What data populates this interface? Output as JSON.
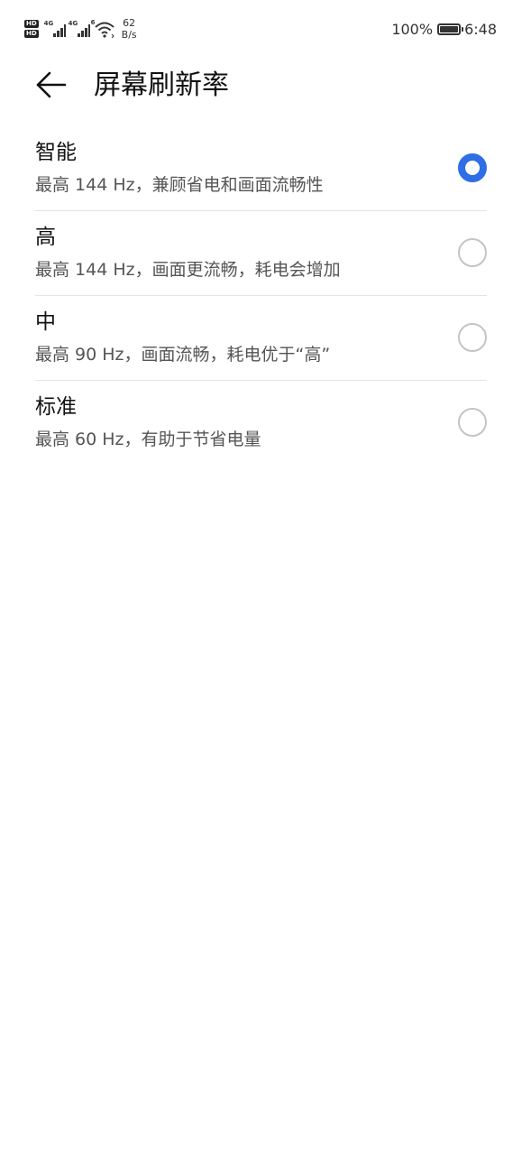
{
  "status_bar": {
    "hd_badge_1": "HD",
    "hd_badge_2": "HD",
    "sim1_tag": "4G",
    "sim2_tag": "4G",
    "wifi_tag": "6",
    "net_speed_value": "62",
    "net_speed_unit": "B/s",
    "battery_percent": "100%",
    "battery_level": 1.0,
    "time": "6:48"
  },
  "header": {
    "title": "屏幕刷新率"
  },
  "options": [
    {
      "title": "智能",
      "desc": "最高 144 Hz，兼顾省电和画面流畅性",
      "checked": true
    },
    {
      "title": "高",
      "desc": "最高 144 Hz，画面更流畅，耗电会增加",
      "checked": false
    },
    {
      "title": "中",
      "desc": "最高 90 Hz，画面流畅，耗电优于“高”",
      "checked": false
    },
    {
      "title": "标准",
      "desc": "最高 60 Hz，有助于节省电量",
      "checked": false
    }
  ],
  "colors": {
    "accent": "#2f6ee5",
    "radio_off": "#c4c4c4",
    "divider": "#e4e4e4"
  }
}
